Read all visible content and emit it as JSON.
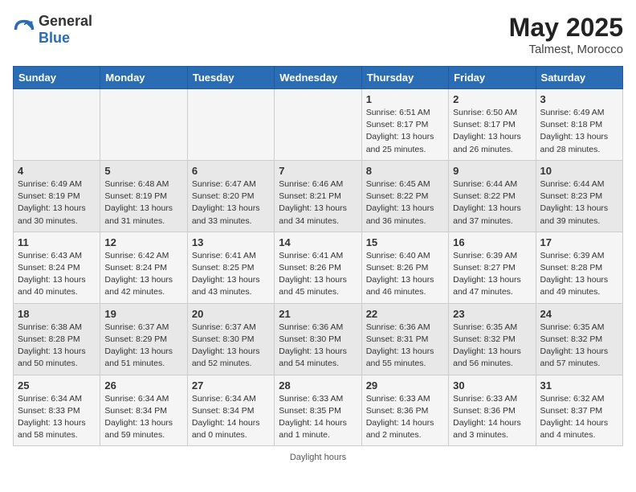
{
  "header": {
    "logo_general": "General",
    "logo_blue": "Blue",
    "month_year": "May 2025",
    "location": "Talmest, Morocco"
  },
  "days_of_week": [
    "Sunday",
    "Monday",
    "Tuesday",
    "Wednesday",
    "Thursday",
    "Friday",
    "Saturday"
  ],
  "footer_text": "Daylight hours",
  "weeks": [
    [
      {
        "day": "",
        "info": ""
      },
      {
        "day": "",
        "info": ""
      },
      {
        "day": "",
        "info": ""
      },
      {
        "day": "",
        "info": ""
      },
      {
        "day": "1",
        "info": "Sunrise: 6:51 AM\nSunset: 8:17 PM\nDaylight: 13 hours\nand 25 minutes."
      },
      {
        "day": "2",
        "info": "Sunrise: 6:50 AM\nSunset: 8:17 PM\nDaylight: 13 hours\nand 26 minutes."
      },
      {
        "day": "3",
        "info": "Sunrise: 6:49 AM\nSunset: 8:18 PM\nDaylight: 13 hours\nand 28 minutes."
      }
    ],
    [
      {
        "day": "4",
        "info": "Sunrise: 6:49 AM\nSunset: 8:19 PM\nDaylight: 13 hours\nand 30 minutes."
      },
      {
        "day": "5",
        "info": "Sunrise: 6:48 AM\nSunset: 8:19 PM\nDaylight: 13 hours\nand 31 minutes."
      },
      {
        "day": "6",
        "info": "Sunrise: 6:47 AM\nSunset: 8:20 PM\nDaylight: 13 hours\nand 33 minutes."
      },
      {
        "day": "7",
        "info": "Sunrise: 6:46 AM\nSunset: 8:21 PM\nDaylight: 13 hours\nand 34 minutes."
      },
      {
        "day": "8",
        "info": "Sunrise: 6:45 AM\nSunset: 8:22 PM\nDaylight: 13 hours\nand 36 minutes."
      },
      {
        "day": "9",
        "info": "Sunrise: 6:44 AM\nSunset: 8:22 PM\nDaylight: 13 hours\nand 37 minutes."
      },
      {
        "day": "10",
        "info": "Sunrise: 6:44 AM\nSunset: 8:23 PM\nDaylight: 13 hours\nand 39 minutes."
      }
    ],
    [
      {
        "day": "11",
        "info": "Sunrise: 6:43 AM\nSunset: 8:24 PM\nDaylight: 13 hours\nand 40 minutes."
      },
      {
        "day": "12",
        "info": "Sunrise: 6:42 AM\nSunset: 8:24 PM\nDaylight: 13 hours\nand 42 minutes."
      },
      {
        "day": "13",
        "info": "Sunrise: 6:41 AM\nSunset: 8:25 PM\nDaylight: 13 hours\nand 43 minutes."
      },
      {
        "day": "14",
        "info": "Sunrise: 6:41 AM\nSunset: 8:26 PM\nDaylight: 13 hours\nand 45 minutes."
      },
      {
        "day": "15",
        "info": "Sunrise: 6:40 AM\nSunset: 8:26 PM\nDaylight: 13 hours\nand 46 minutes."
      },
      {
        "day": "16",
        "info": "Sunrise: 6:39 AM\nSunset: 8:27 PM\nDaylight: 13 hours\nand 47 minutes."
      },
      {
        "day": "17",
        "info": "Sunrise: 6:39 AM\nSunset: 8:28 PM\nDaylight: 13 hours\nand 49 minutes."
      }
    ],
    [
      {
        "day": "18",
        "info": "Sunrise: 6:38 AM\nSunset: 8:28 PM\nDaylight: 13 hours\nand 50 minutes."
      },
      {
        "day": "19",
        "info": "Sunrise: 6:37 AM\nSunset: 8:29 PM\nDaylight: 13 hours\nand 51 minutes."
      },
      {
        "day": "20",
        "info": "Sunrise: 6:37 AM\nSunset: 8:30 PM\nDaylight: 13 hours\nand 52 minutes."
      },
      {
        "day": "21",
        "info": "Sunrise: 6:36 AM\nSunset: 8:30 PM\nDaylight: 13 hours\nand 54 minutes."
      },
      {
        "day": "22",
        "info": "Sunrise: 6:36 AM\nSunset: 8:31 PM\nDaylight: 13 hours\nand 55 minutes."
      },
      {
        "day": "23",
        "info": "Sunrise: 6:35 AM\nSunset: 8:32 PM\nDaylight: 13 hours\nand 56 minutes."
      },
      {
        "day": "24",
        "info": "Sunrise: 6:35 AM\nSunset: 8:32 PM\nDaylight: 13 hours\nand 57 minutes."
      }
    ],
    [
      {
        "day": "25",
        "info": "Sunrise: 6:34 AM\nSunset: 8:33 PM\nDaylight: 13 hours\nand 58 minutes."
      },
      {
        "day": "26",
        "info": "Sunrise: 6:34 AM\nSunset: 8:34 PM\nDaylight: 13 hours\nand 59 minutes."
      },
      {
        "day": "27",
        "info": "Sunrise: 6:34 AM\nSunset: 8:34 PM\nDaylight: 14 hours\nand 0 minutes."
      },
      {
        "day": "28",
        "info": "Sunrise: 6:33 AM\nSunset: 8:35 PM\nDaylight: 14 hours\nand 1 minute."
      },
      {
        "day": "29",
        "info": "Sunrise: 6:33 AM\nSunset: 8:36 PM\nDaylight: 14 hours\nand 2 minutes."
      },
      {
        "day": "30",
        "info": "Sunrise: 6:33 AM\nSunset: 8:36 PM\nDaylight: 14 hours\nand 3 minutes."
      },
      {
        "day": "31",
        "info": "Sunrise: 6:32 AM\nSunset: 8:37 PM\nDaylight: 14 hours\nand 4 minutes."
      }
    ]
  ]
}
